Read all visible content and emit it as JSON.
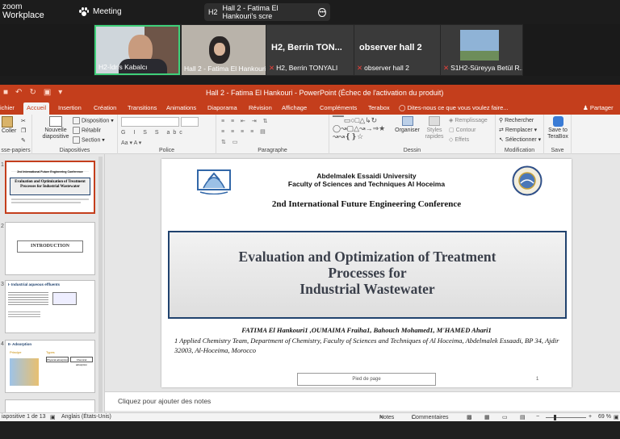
{
  "zoom": {
    "logo_line1": "zoom",
    "logo_line2": "Workplace",
    "meeting_label": "Meeting",
    "share_badge": "H2",
    "share_title": "Hall 2 - Fatima El Hankouri's scre",
    "share_more": "•••"
  },
  "participants": [
    {
      "name": "H2-İdris Kabalcı",
      "muted": false
    },
    {
      "name": "Hall 2 - Fatima El Hankouri",
      "muted": false
    },
    {
      "big": "H2, Berrin TON...",
      "name": "H2, Berrin TONYALI",
      "muted": true
    },
    {
      "big": "observer hall 2",
      "name": "observer hall 2",
      "muted": true
    },
    {
      "name": "S1H2-Süreyya Betül R...",
      "muted": true
    }
  ],
  "powerpoint": {
    "window_title": "Hall 2 - Fatima El Hankouri - PowerPoint (Échec de l'activation du produit)",
    "tabs": [
      "ichier",
      "Accueil",
      "Insertion",
      "Création",
      "Transitions",
      "Animations",
      "Diaporama",
      "Révision",
      "Affichage",
      "Compléments",
      "Terabox"
    ],
    "active_tab": "Accueil",
    "tell_me": "Dites-nous ce que vous voulez faire...",
    "share": "Partager",
    "ribbon": {
      "coller": "Coller",
      "nouvelle_diapositive": "Nouvelle diapositive",
      "disposition": "Disposition",
      "retablir": "Rétablir",
      "section": "Section",
      "organiser": "Organiser",
      "styles_rapides": "Styles rapides",
      "remplissage": "Remplissage",
      "contour": "Contour",
      "effets": "Effets",
      "rechercher": "Rechercher",
      "remplacer": "Remplacer",
      "selectionner": "Sélectionner",
      "save_to_terabox": "Save to TeraBox",
      "groups": {
        "presse_papiers": "sse-papiers",
        "diapositives": "Diapositives",
        "police": "Police",
        "paragraphe": "Paragraphe",
        "dessin": "Dessin",
        "modification": "Modification",
        "save": "Save"
      }
    },
    "thumbnails": [
      {
        "num": "1",
        "title": "Evaluation and Optimization of Treatment Processes for Industrial Wastewater",
        "conf": "2nd International Future Engineering Conference"
      },
      {
        "num": "2",
        "title": "INTRODUCTION"
      },
      {
        "num": "3",
        "title": "I- Industrial aqueous effluents"
      },
      {
        "num": "4",
        "title": "II- Adsorption",
        "sub1": "Principe",
        "sub2": "Types",
        "box1": "Physical adsorption",
        "box2": "Chemical adsorption"
      }
    ],
    "slide": {
      "university": "Abdelmalek Essaidi University",
      "faculty": "Faculty of Sciences and Techniques Al Hoceima",
      "conference": "2nd International Future Engineering Conference",
      "title_line1": "Evaluation and Optimization of  Treatment",
      "title_line2": "Processes for",
      "title_line3": "Industrial Wastewater",
      "authors": "FATIMA El Hankouri1 ,OUMAIMA Fraiha1, Bahouch Mohamed1, M'HAMED Ahari1",
      "affiliation": "1 Applied Chemistry Team, Department of Chemistry, Faculty of Sciences and Techniques of Al Hoceima, Abdelmalek Essaadi, BP 34, Ajdir 32003, Al-Hoceima, Morocco",
      "footer": "Pied de page",
      "page_number": "1"
    },
    "notes_placeholder": "Cliquez pour ajouter des notes",
    "status": {
      "slide_count": "iapositive 1 de 13",
      "language": "Anglais (États-Unis)",
      "notes": "Notes",
      "comments": "Commentaires",
      "zoom": "69 %"
    }
  },
  "colors": {
    "ppt_accent": "#c43e1c",
    "title_border": "#20426e",
    "speaker_border": "#3fd07a"
  }
}
